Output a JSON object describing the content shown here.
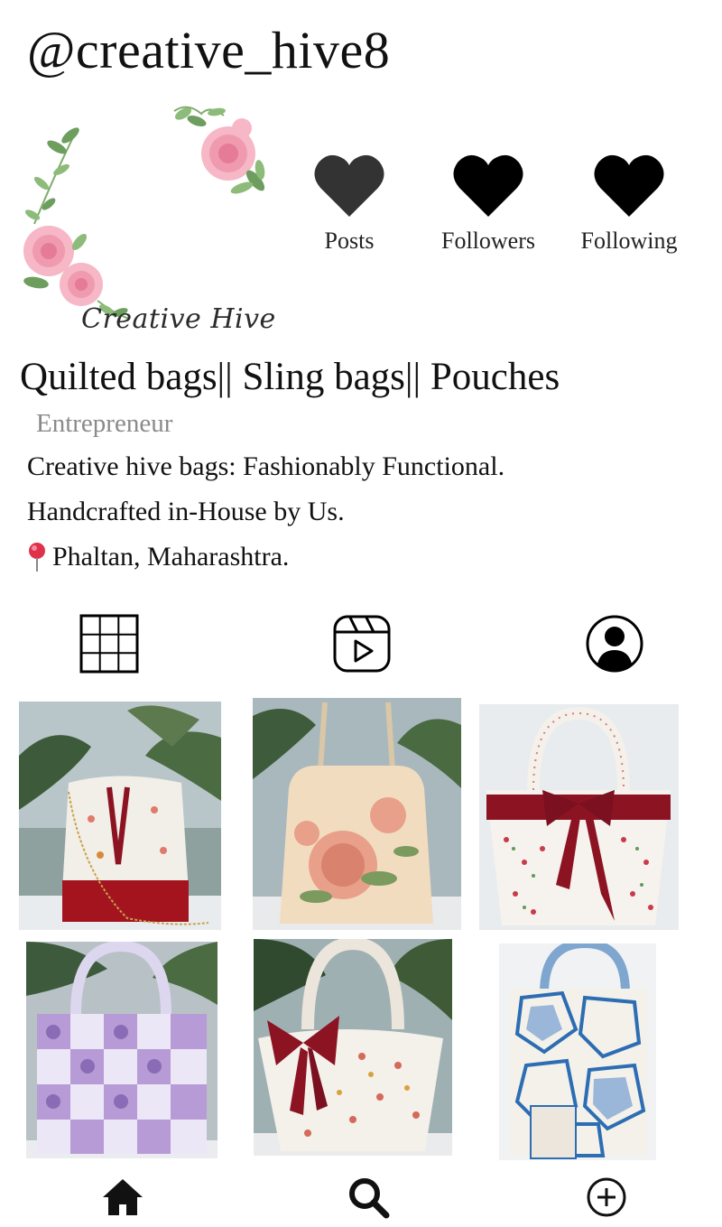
{
  "profile": {
    "username": "@creative_hive8",
    "logo_text": "Creative Hive"
  },
  "stats": {
    "posts_label": "Posts",
    "followers_label": "Followers",
    "following_label": "Following"
  },
  "bio": {
    "title": "Quilted bags|| Sling bags|| Pouches",
    "category": "Entrepreneur",
    "line1": "Creative hive bags: Fashionably Functional.",
    "line2": "Handcrafted in-House by Us.",
    "location": "Phaltan, Maharashtra."
  },
  "tabs": [
    "grid-icon",
    "reels-icon",
    "tagged-icon"
  ],
  "posts": [
    {
      "subject": "drawstring-bucket-bag",
      "accent": "#a3141f"
    },
    {
      "subject": "floral-quilted-handbag",
      "accent": "#e8a08a"
    },
    {
      "subject": "floral-tote-with-bow",
      "accent": "#8c1322"
    },
    {
      "subject": "lavender-patchwork-tote",
      "accent": "#b79bd6"
    },
    {
      "subject": "floral-bag-with-red-bow",
      "accent": "#8c1322"
    },
    {
      "subject": "blue-geometric-tote",
      "accent": "#2c6db3"
    }
  ],
  "bottom_nav": [
    "home-icon",
    "search-icon",
    "add-icon"
  ],
  "colors": {
    "heart": "#111111",
    "muted": "#8a8a8a",
    "rose": "#f2a5b8",
    "leaf": "#6fa36a"
  }
}
